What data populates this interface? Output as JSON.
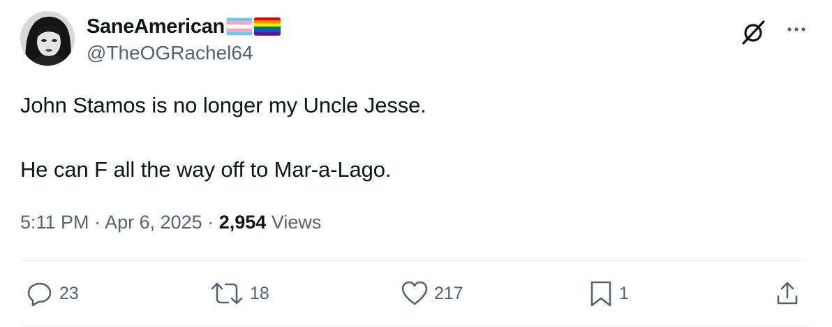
{
  "author": {
    "display_name": "SaneAmerican",
    "handle": "@TheOGRachel64",
    "avatar_icon": "profile-photo",
    "name_emojis": [
      "transgender-flag",
      "rainbow-flag"
    ]
  },
  "header_icons": [
    "grok-icon",
    "more-options-icon"
  ],
  "tweet": {
    "paragraphs": [
      "John Stamos is no longer my Uncle Jesse.",
      "He can F all the way off to Mar-a-Lago."
    ]
  },
  "meta": {
    "time": "5:11 PM",
    "separator": "·",
    "date": "Apr 6, 2025",
    "views_count": "2,954",
    "views_label": "Views"
  },
  "actions": {
    "replies": "23",
    "reposts": "18",
    "likes": "217",
    "bookmarks": "1"
  },
  "colors": {
    "text": "#0f1419",
    "secondary": "#536471",
    "divider": "#eff3f4"
  }
}
